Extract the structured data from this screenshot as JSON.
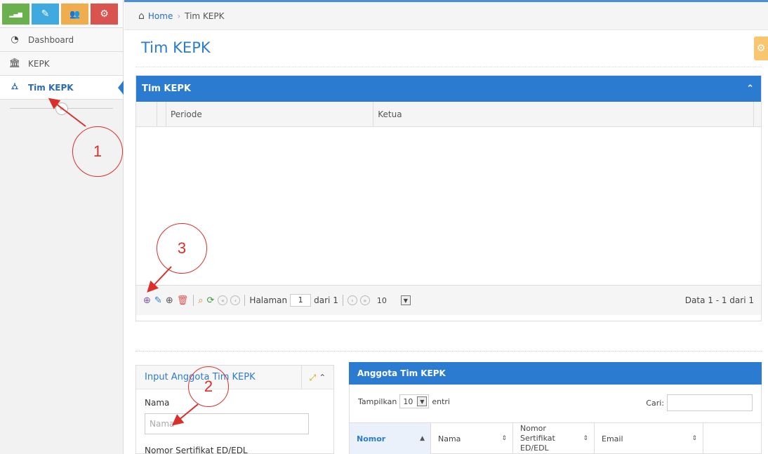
{
  "sidebar": {
    "shortcuts": [
      {
        "icon": "bar-chart-icon",
        "color": "#6ab04c",
        "glyph": "▂▄▆"
      },
      {
        "icon": "pencil-icon",
        "color": "#3fa9e0",
        "glyph": "✎"
      },
      {
        "icon": "users-icon",
        "color": "#f0ad4e",
        "glyph": "👥"
      },
      {
        "icon": "cogs-icon",
        "color": "#d9534f",
        "glyph": "⚙"
      }
    ],
    "items": [
      {
        "label": "Dashboard",
        "icon": "dashboard-icon",
        "active": false
      },
      {
        "label": "KEPK",
        "icon": "bank-icon",
        "active": false
      },
      {
        "label": "Tim KEPK",
        "icon": "sitemap-icon",
        "active": true
      }
    ],
    "collapse_glyph": "«"
  },
  "breadcrumb": {
    "home": "Home",
    "separator": "›",
    "current": "Tim KEPK"
  },
  "page": {
    "title": "Tim KEPK"
  },
  "grid": {
    "title": "Tim KEPK",
    "columns": [
      "Periode",
      "Ketua"
    ],
    "pager": {
      "page_label": "Halaman",
      "page_value": "1",
      "of_label": "dari 1",
      "page_size": "10",
      "info": "Data 1 - 1 dari 1"
    }
  },
  "input_panel": {
    "title": "Input Anggota Tim KEPK",
    "field1_label": "Nama",
    "field1_placeholder": "Nama",
    "field2_label": "Nomor Sertifikat ED/EDL"
  },
  "anggota": {
    "title": "Anggota Tim KEPK",
    "show_label": "Tampilkan",
    "show_value": "10",
    "entries_label": "entri",
    "search_label": "Cari:",
    "columns": [
      "Nomor",
      "Nama",
      "Nomor Sertifikat ED/EDL",
      "Email"
    ]
  },
  "annotations": [
    "1",
    "2",
    "3"
  ],
  "colors": {
    "primary": "#2b7bd0",
    "annotation": "#d9302c",
    "settings": "#f9c56f"
  }
}
